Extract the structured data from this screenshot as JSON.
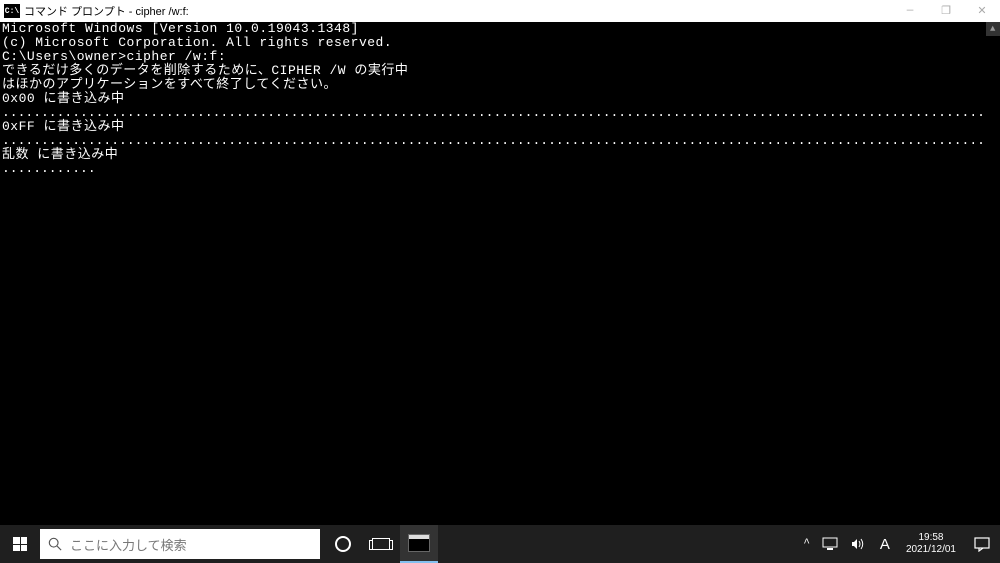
{
  "titlebar": {
    "icon_text": "C:\\",
    "title": "コマンド プロンプト - cipher  /w:f:",
    "min_icon": "—",
    "max_icon": "❐",
    "close_icon": "✕"
  },
  "terminal": {
    "lines": [
      "Microsoft Windows [Version 10.0.19043.1348]",
      "(c) Microsoft Corporation. All rights reserved.",
      "",
      "C:\\Users\\owner>cipher /w:f:",
      "できるだけ多くのデータを削除するために、CIPHER /W の実行中",
      "はほかのアプリケーションをすべて終了してください。",
      "0x00 に書き込み中"
    ],
    "dots1": "..........................................................................................................................................",
    "line_ff": "0xFF に書き込み中",
    "dots2": "..........................................................................................................................................",
    "line_rand": "乱数 に書き込み中",
    "dots3": "............"
  },
  "taskbar": {
    "search_placeholder": "ここに入力して検索",
    "tray": {
      "chevron": "^",
      "monitor": "🖥",
      "sound": "🔊",
      "ime": "A",
      "time": "19:58",
      "date": "2021/12/01",
      "notif": "💬"
    }
  }
}
